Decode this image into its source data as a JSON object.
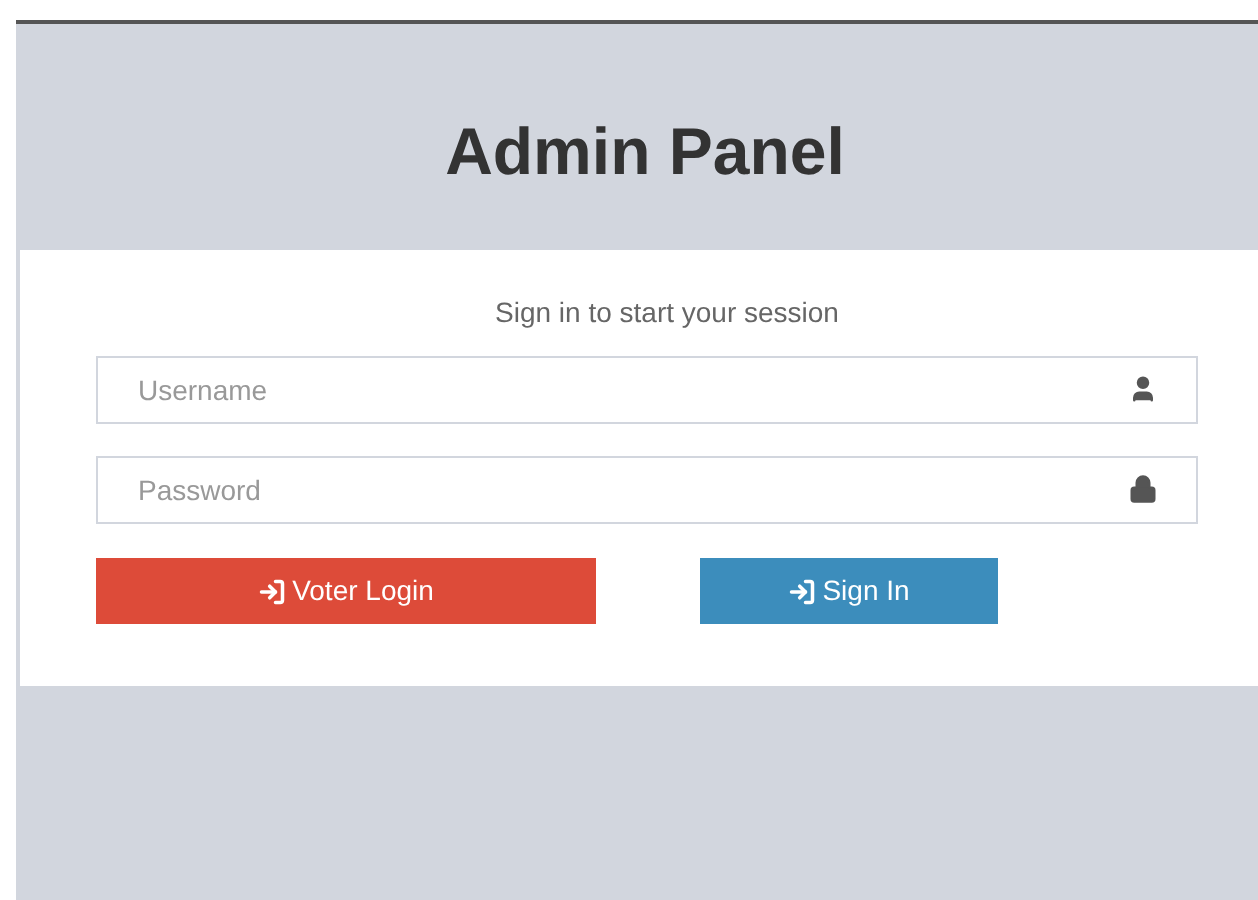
{
  "title": "Admin Panel",
  "card": {
    "message": "Sign in to start your session",
    "fields": [
      {
        "placeholder": "Username",
        "kind": "user"
      },
      {
        "placeholder": "Password",
        "kind": "lock"
      }
    ],
    "buttons": [
      {
        "label": "Voter Login",
        "kind": "danger"
      },
      {
        "label": "Sign In",
        "kind": "primary"
      }
    ]
  }
}
